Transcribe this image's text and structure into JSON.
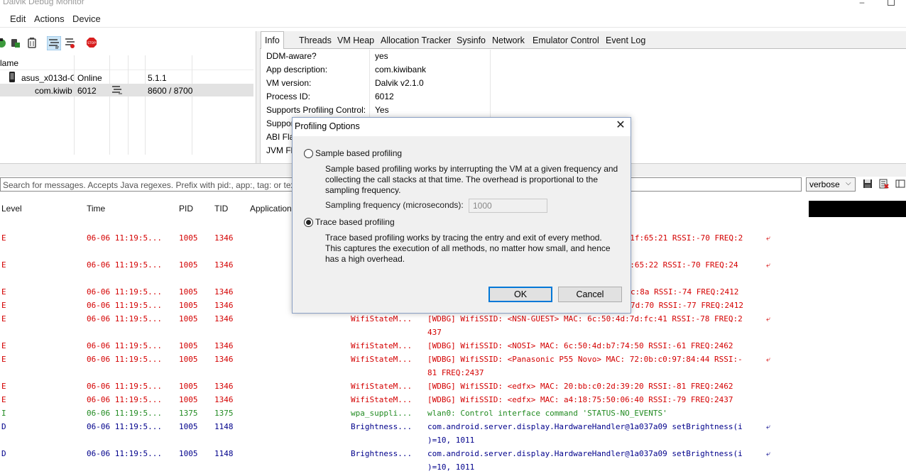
{
  "window": {
    "title": "Dalvik Debug Monitor",
    "min_icon": "minimize-icon",
    "max_icon": "maximize-icon"
  },
  "menu": [
    "Edit",
    "Actions",
    "Device"
  ],
  "device_panel": {
    "toolbar_icons": [
      "debug-icon",
      "update-heap-icon",
      "dump-hprof-icon",
      "cause-gc-icon",
      "update-threads-icon",
      "start-method-profiling-icon",
      "stop-process-icon"
    ],
    "column_header": "lame",
    "rows": [
      {
        "name": "asus_x013d-G(",
        "status": "Online",
        "col3": "",
        "version": "5.1.1",
        "icon": "phone-icon"
      },
      {
        "name": "com.kiwib",
        "status": "6012",
        "col3": "profiling-icon",
        "version": "8600 / 8700"
      }
    ]
  },
  "tabs": [
    "Info",
    "Threads",
    "VM Heap",
    "Allocation Tracker",
    "Sysinfo",
    "Network",
    "Emulator Control",
    "Event Log"
  ],
  "active_tab": "Info",
  "info": [
    {
      "label": "DDM-aware?",
      "value": "yes"
    },
    {
      "label": "App description:",
      "value": "com.kiwibank"
    },
    {
      "label": "VM version:",
      "value": "Dalvik v2.1.0"
    },
    {
      "label": "Process ID:",
      "value": "6012"
    },
    {
      "label": "Supports Profiling Control:",
      "value": "Yes"
    },
    {
      "label": "Suppor",
      "value": ""
    },
    {
      "label": "ABI Fla",
      "value": ""
    },
    {
      "label": "JVM Fla",
      "value": ""
    }
  ],
  "logcat": {
    "search_placeholder": "Search for messages. Accepts Java regexes. Prefix with pid:, app:, tag: or text: t",
    "level": "verbose",
    "tool_icons": [
      "save-icon",
      "clear-log-icon",
      "toggle-view-icon"
    ],
    "headers": [
      "Level",
      "Time",
      "PID",
      "TID",
      "Application"
    ],
    "rows": [
      {
        "level": "E",
        "time": "06-06 11:19:5...",
        "pid": "1005",
        "tid": "1346",
        "tag": "",
        "text": "3:1f:65:21 RSSI:-70 FREQ:2",
        "wrap": true
      },
      {
        "level": "E",
        "time": "06-06 11:19:5...",
        "pid": "1005",
        "tid": "1346",
        "tag": "",
        "text": "1f:65:22 RSSI:-70 FREQ:24",
        "wrap": true
      },
      {
        "level": "E",
        "time": "06-06 11:19:5...",
        "pid": "1005",
        "tid": "1346",
        "tag": "",
        "text": "c:8a RSSI:-74 FREQ:2412",
        "wrap": false
      },
      {
        "level": "E",
        "time": "06-06 11:19:5...",
        "pid": "1005",
        "tid": "1346",
        "tag": "",
        "text": "7d:70 RSSI:-77 FREQ:2412",
        "wrap": false
      },
      {
        "level": "E",
        "time": "06-06 11:19:5...",
        "pid": "1005",
        "tid": "1346",
        "tag": "WifiStateM...",
        "text": "[WDBG] WifiSSID: <NSN-GUEST> MAC: 6c:50:4d:7d:fc:41 RSSI:-78 FREQ:2",
        "wrap": true,
        "cont": "437"
      },
      {
        "level": "E",
        "time": "06-06 11:19:5...",
        "pid": "1005",
        "tid": "1346",
        "tag": "WifiStateM...",
        "text": "[WDBG] WifiSSID: <NOSI> MAC: 6c:50:4d:b7:74:50 RSSI:-61 FREQ:2462",
        "wrap": false
      },
      {
        "level": "E",
        "time": "06-06 11:19:5...",
        "pid": "1005",
        "tid": "1346",
        "tag": "WifiStateM...",
        "text": "[WDBG] WifiSSID: <Panasonic P55 Novo> MAC: 72:0b:c0:97:84:44 RSSI:-",
        "wrap": true,
        "cont": "81 FREQ:2437"
      },
      {
        "level": "E",
        "time": "06-06 11:19:5...",
        "pid": "1005",
        "tid": "1346",
        "tag": "WifiStateM...",
        "text": "[WDBG] WifiSSID: <edfx> MAC: 20:bb:c0:2d:39:20 RSSI:-81 FREQ:2462",
        "wrap": false
      },
      {
        "level": "E",
        "time": "06-06 11:19:5...",
        "pid": "1005",
        "tid": "1346",
        "tag": "WifiStateM...",
        "text": "[WDBG] WifiSSID: <edfx> MAC: a4:18:75:50:06:40 RSSI:-79 FREQ:2437",
        "wrap": false
      },
      {
        "level": "I",
        "time": "06-06 11:19:5...",
        "pid": "1375",
        "tid": "1375",
        "tag": "wpa_suppli...",
        "text": "wlan0: Control interface command 'STATUS-NO_EVENTS'",
        "wrap": false
      },
      {
        "level": "D",
        "time": "06-06 11:19:5...",
        "pid": "1005",
        "tid": "1148",
        "tag": "Brightness...",
        "text": "com.android.server.display.HardwareHandler@1a037a09 setBrightness(i",
        "wrap": true,
        "cont": ")=10, 1011"
      },
      {
        "level": "D",
        "time": "06-06 11:19:5...",
        "pid": "1005",
        "tid": "1148",
        "tag": "Brightness...",
        "text": "com.android.server.display.HardwareHandler@1a037a09 setBrightness(i",
        "wrap": true,
        "cont": ")=10, 1011"
      }
    ]
  },
  "dialog": {
    "title": "Profiling Options",
    "sample_label": "Sample based profiling",
    "sample_desc": [
      "Sample based profiling works by interrupting the VM at a given frequency and",
      "collecting the call stacks at that time. The overhead is proportional to the",
      "sampling frequency."
    ],
    "freq_label": "Sampling frequency (microseconds):",
    "freq_value": "1000",
    "trace_label": "Trace based profiling",
    "trace_desc": [
      "Trace based profiling works by tracing the entry and exit of every method.",
      "This captures the execution of all methods, no matter how small, and hence",
      "has a high overhead."
    ],
    "selected": "trace",
    "ok_label": "OK",
    "cancel_label": "Cancel"
  },
  "colors": {
    "error": "#d40000",
    "info": "#228b22",
    "debug": "#00008b",
    "focus": "#0078d7"
  }
}
